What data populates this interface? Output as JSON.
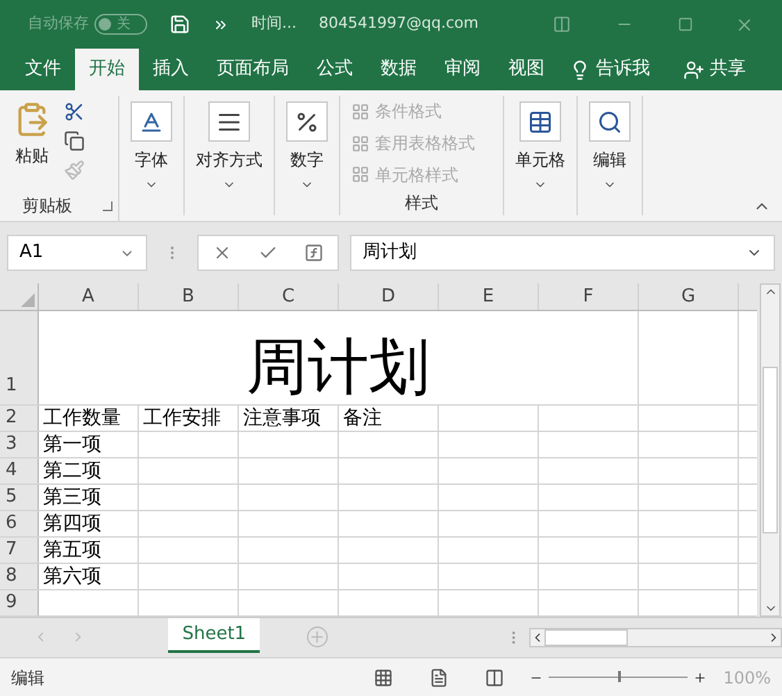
{
  "title_bar": {
    "autosave": {
      "label": "自动保存",
      "toggle": "关",
      "on": false
    },
    "title": "时间...",
    "account": "804541997@qq.com"
  },
  "ribbon_tabs": [
    {
      "label": "文件",
      "selected": false
    },
    {
      "label": "开始",
      "selected": true
    },
    {
      "label": "插入",
      "selected": false
    },
    {
      "label": "页面布局",
      "selected": false
    },
    {
      "label": "公式",
      "selected": false
    },
    {
      "label": "数据",
      "selected": false
    },
    {
      "label": "审阅",
      "selected": false
    },
    {
      "label": "视图",
      "selected": false
    }
  ],
  "tell_me": "告诉我",
  "share": "共享",
  "ribbon": {
    "clipboard": {
      "paste": "粘贴",
      "label": "剪贴板"
    },
    "buttons": [
      {
        "kind": "font",
        "label": "字体"
      },
      {
        "kind": "align",
        "label": "对齐方式"
      },
      {
        "kind": "number",
        "label": "数字"
      }
    ],
    "styles": {
      "label": "样式",
      "items": [
        {
          "label": "条件格式",
          "disabled": true
        },
        {
          "label": "套用表格格式",
          "disabled": true
        },
        {
          "label": "单元格样式",
          "disabled": true
        }
      ]
    },
    "tail_buttons": [
      {
        "kind": "cells",
        "label": "单元格"
      },
      {
        "kind": "edit",
        "label": "编辑"
      }
    ]
  },
  "formula_bar": {
    "name_box": "A1",
    "value": "周计划"
  },
  "columns": [
    "A",
    "B",
    "C",
    "D",
    "E",
    "F",
    "G"
  ],
  "title_row": {
    "number": "1",
    "text": "周计划"
  },
  "rows": [
    {
      "number": "2",
      "cells": [
        "工作数量",
        "工作安排",
        "注意事项",
        "备注"
      ]
    },
    {
      "number": "3",
      "cells": [
        "第一项"
      ]
    },
    {
      "number": "4",
      "cells": [
        "第二项"
      ]
    },
    {
      "number": "5",
      "cells": [
        "第三项"
      ]
    },
    {
      "number": "6",
      "cells": [
        "第四项"
      ]
    },
    {
      "number": "7",
      "cells": [
        "第五项"
      ]
    },
    {
      "number": "8",
      "cells": [
        "第六项"
      ]
    },
    {
      "number": "9",
      "cells": []
    }
  ],
  "sheet_tabs": [
    {
      "label": "Sheet1",
      "selected": true
    }
  ],
  "status_bar": {
    "mode": "编辑",
    "zoom": "100%",
    "zoom_slider": {
      "level": 0.5
    }
  }
}
